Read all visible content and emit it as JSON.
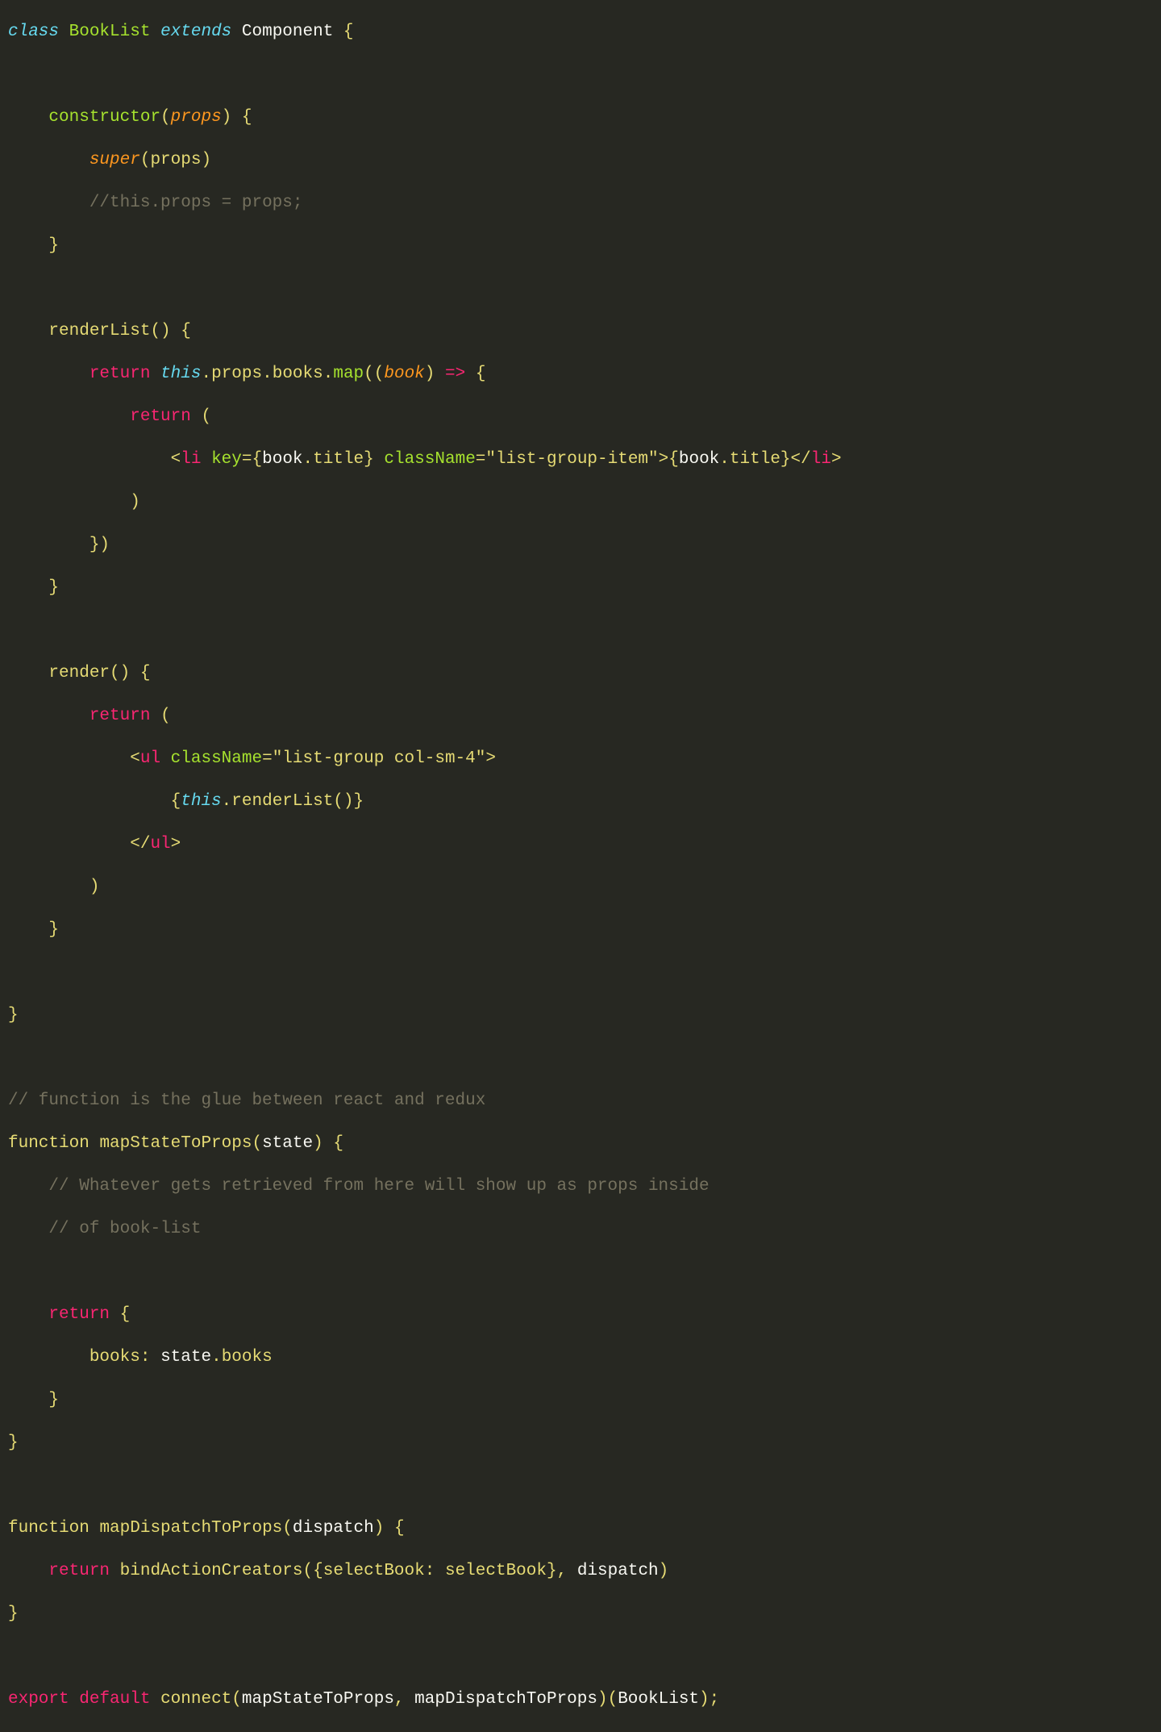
{
  "code": {
    "l1": {
      "kw1": "class",
      "name": "BookList",
      "kw2": "extends",
      "comp": "Component",
      "brace": "{"
    },
    "l2": "",
    "l3": {
      "ctor": "constructor",
      "paren1": "(",
      "param": "props",
      "paren2": ")",
      "brace": "{"
    },
    "l4": {
      "super": "super",
      "paren1": "(",
      "arg": "props",
      "paren2": ")"
    },
    "l5": {
      "comment": "//this.props = props;"
    },
    "l6": {
      "brace": "}"
    },
    "l7": "",
    "l8": {
      "name": "renderList",
      "paren": "()",
      "brace": "{"
    },
    "l9": {
      "ret": "return",
      "this": "this",
      "d1": ".",
      "props": "props",
      "d2": ".",
      "books": "books",
      "d3": ".",
      "map": "map",
      "open": "((",
      "book": "book",
      "close": ")",
      "arrow": "=>",
      "brace": "{"
    },
    "l10": {
      "ret": "return",
      "open": "("
    },
    "l11": {
      "open": "<",
      "tag": "li",
      "sp": " ",
      "attr1": "key",
      "eq1": "=",
      "vopen1": "{",
      "obj1": "book",
      "dot1": ".",
      "prop1": "title",
      "vclose1": "}",
      "sp2": " ",
      "attr2": "className",
      "eq2": "=",
      "str": "\"list-group-item\"",
      "close1": ">",
      "copen": "{",
      "obj2": "book",
      "dot2": ".",
      "prop2": "title",
      "cclose": "}",
      "close2": "</",
      "tag2": "li",
      "close3": ">"
    },
    "l12": {
      "close": ")"
    },
    "l13": {
      "close": "})"
    },
    "l14": {
      "brace": "}"
    },
    "l15": "",
    "l16": {
      "name": "render",
      "paren": "()",
      "brace": "{"
    },
    "l17": {
      "ret": "return",
      "open": "("
    },
    "l18": {
      "open": "<",
      "tag": "ul",
      "sp": " ",
      "attr": "className",
      "eq": "=",
      "str": "\"list-group col-sm-4\"",
      "close": ">"
    },
    "l19": {
      "open": "{",
      "this": "this",
      "dot": ".",
      "call": "renderList()",
      "close": "}"
    },
    "l20": {
      "open": "</",
      "tag": "ul",
      "close": ">"
    },
    "l21": {
      "close": ")"
    },
    "l22": {
      "brace": "}"
    },
    "l23": "",
    "l24": {
      "brace": "}"
    },
    "l25": "",
    "l26": {
      "comment": "// function is the glue between react and redux"
    },
    "l27": {
      "fn": "function",
      "name": "mapStateToProps",
      "open": "(",
      "param": "state",
      "close": ")",
      "brace": "{"
    },
    "l28": {
      "comment": "// Whatever gets retrieved from here will show up as props inside"
    },
    "l29": {
      "comment": "// of book-list"
    },
    "l30": "",
    "l31": {
      "ret": "return",
      "brace": "{"
    },
    "l32": {
      "key": "books",
      "colon": ":",
      "obj": "state",
      "dot": ".",
      "prop": "books"
    },
    "l33": {
      "brace": "}"
    },
    "l34": {
      "brace": "}"
    },
    "l35": "",
    "l36": {
      "fn": "function",
      "name": "mapDispatchToProps",
      "open": "(",
      "param": "dispatch",
      "close": ")",
      "brace": "{"
    },
    "l37": {
      "ret": "return",
      "call": "bindActionCreators",
      "open": "(",
      "brace1": "{",
      "key": "selectBook",
      "colon": ":",
      "val": "selectBook",
      "brace2": "}",
      "comma": ",",
      "arg": "dispatch",
      "close": ")"
    },
    "l38": {
      "brace": "}"
    },
    "l39": "",
    "l40": {
      "exp": "export",
      "def": "default",
      "call": "connect",
      "open": "(",
      "a1": "mapStateToProps",
      "comma": ",",
      "a2": "mapDispatchToProps",
      "close": ")(",
      "a3": "BookList",
      "close2": ");"
    }
  }
}
